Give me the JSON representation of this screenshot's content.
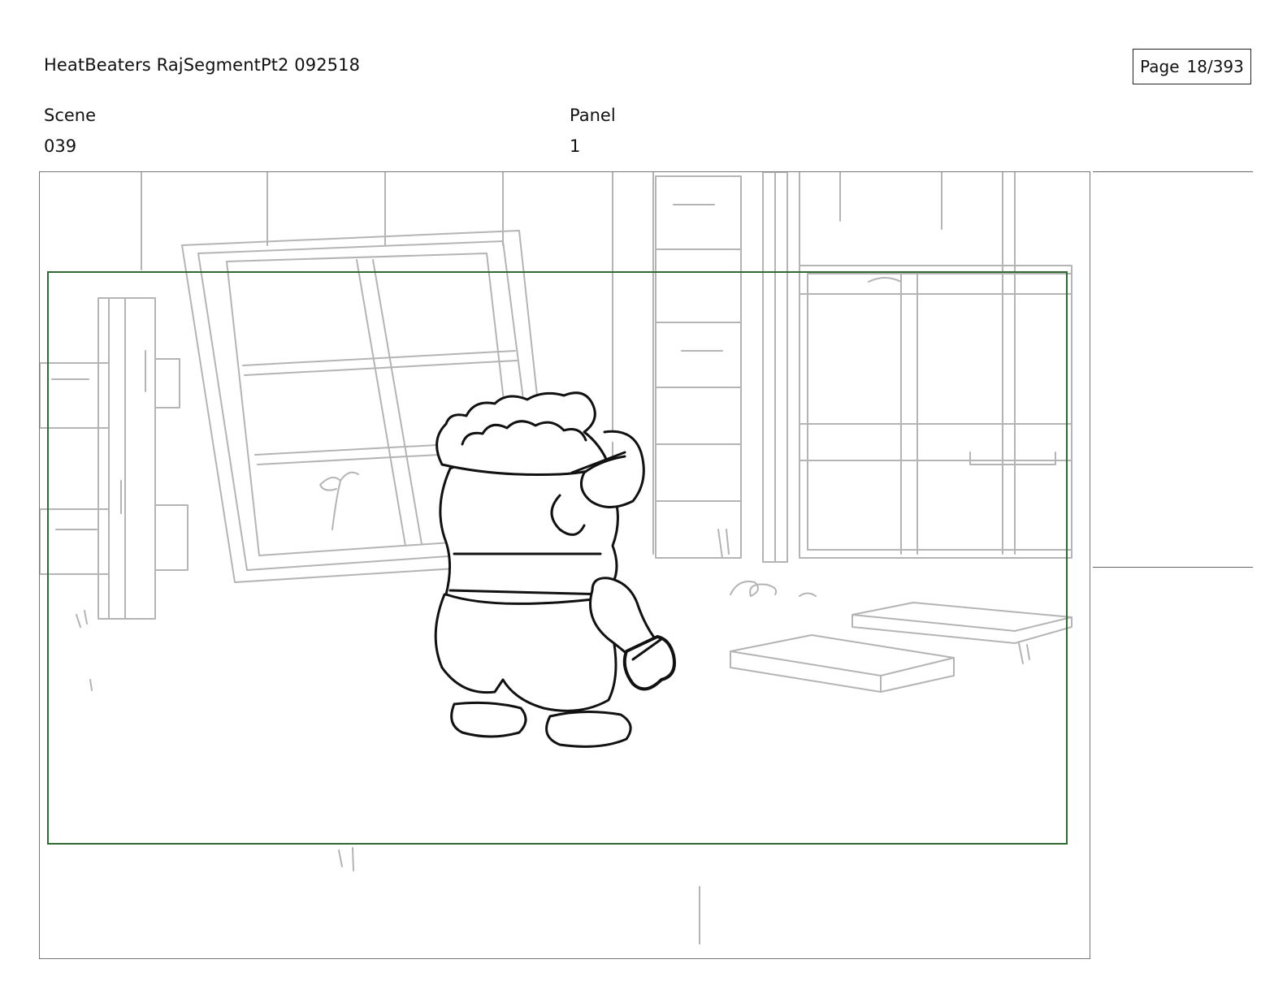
{
  "header": {
    "title": "HeatBeaters RajSegmentPt2 092518",
    "page_label": "Page",
    "page_number": "18/393"
  },
  "fields": {
    "scene_label": "Scene",
    "scene_value": "039",
    "panel_label": "Panel",
    "panel_value": "1"
  },
  "panel": {
    "safe_area_color": "#2e6b2e",
    "background_line_color": "#b4b4b4",
    "character_line_color": "#111111"
  }
}
